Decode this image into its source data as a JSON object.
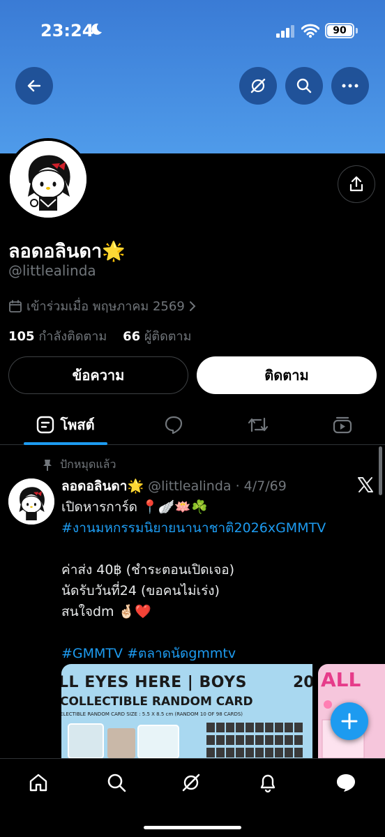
{
  "status_bar": {
    "time": "23:24",
    "battery": "90"
  },
  "profile": {
    "display_name": "ลอดอลินดา🌟",
    "handle": "@littlealinda",
    "joined": "เข้าร่วมเมื่อ พฤษภาคม 2569",
    "following_count": "105",
    "following_label": "กำลังติดตาม",
    "followers_count": "66",
    "followers_label": "ผู้ติดตาม"
  },
  "actions": {
    "message_label": "ข้อความ",
    "follow_label": "ติดตาม"
  },
  "tabs": {
    "posts_label": "โพสต์"
  },
  "post": {
    "pinned_label": "ปักหมุดแล้ว",
    "author_name": "ลอดอลินดา🌟",
    "author_handle": "@littlealinda",
    "date": "· 4/7/69",
    "line1": "เปิดหารการ์ด 📍🪽🪷☘️",
    "hashtag1": "#งานมหกรรมนิยายนานาชาติ2026xGMMTV",
    "line2": "ค่าส่ง 40฿ (ชำระตอนเปิดเจอ)",
    "line3": "นัดรับวันที่24 (ขอคนไม่เร่ง)",
    "line4": "สนใจdm 🤞🏻❤️",
    "hashtag2": "#GMMTV",
    "hashtag3": "#ตลาดนัดgmmtv",
    "media1_title": "LL EYES HERE | BOYS",
    "media1_subtitle": "COLLECTIBLE RANDOM CARD",
    "media1_small": "ELECTIBLE RANDOM CARD SIZE : 5.5 X 8.5 cm (RANDOM 10 OF 98 CARDS)",
    "media1_corner": "20",
    "media2_text": "ALL"
  },
  "icons": [
    "back-arrow-icon",
    "grok-icon",
    "search-icon",
    "more-icon",
    "share-icon",
    "calendar-icon",
    "chevron-right-icon",
    "pin-icon",
    "x-logo-icon",
    "plus-icon",
    "home-icon",
    "notifications-icon",
    "messages-icon"
  ],
  "colors": {
    "accent": "#1d9bf0",
    "banner": "#4f9bea",
    "background": "#000000"
  }
}
